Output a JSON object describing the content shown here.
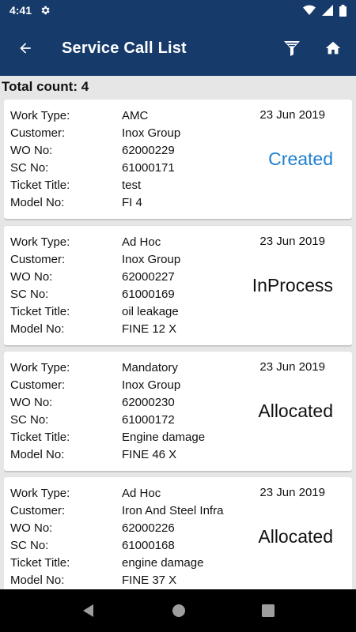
{
  "status_bar": {
    "time": "4:41"
  },
  "app_bar": {
    "title": "Service Call List"
  },
  "summary": {
    "total_count": "Total count: 4"
  },
  "labels": {
    "work_type": "Work Type:",
    "customer": "Customer:",
    "wo_no": "WO No:",
    "sc_no": "SC No:",
    "ticket_title": "Ticket Title:",
    "model_no": "Model No:"
  },
  "calls": [
    {
      "work_type": "AMC",
      "customer": "Inox Group",
      "wo_no": "62000229",
      "sc_no": "61000171",
      "ticket_title": "test",
      "model_no": "FI 4",
      "date": "23 Jun 2019",
      "status": "Created",
      "status_color": "#1e7fd0"
    },
    {
      "work_type": "Ad Hoc",
      "customer": "Inox Group",
      "wo_no": "62000227",
      "sc_no": "61000169",
      "ticket_title": "oil leakage",
      "model_no": "FINE 12 X",
      "date": "23 Jun 2019",
      "status": "InProcess",
      "status_color": "#111111"
    },
    {
      "work_type": "Mandatory",
      "customer": "Inox Group",
      "wo_no": "62000230",
      "sc_no": "61000172",
      "ticket_title": "Engine damage",
      "model_no": "FINE 46 X",
      "date": "23 Jun 2019",
      "status": "Allocated",
      "status_color": "#111111"
    },
    {
      "work_type": "Ad Hoc",
      "customer": "Iron And Steel Infra",
      "wo_no": "62000226",
      "sc_no": "61000168",
      "ticket_title": "engine damage",
      "model_no": "FINE 37 X",
      "date": "23 Jun 2019",
      "status": "Allocated",
      "status_color": "#111111"
    }
  ],
  "colors": {
    "primary": "#163a6a",
    "background": "#e6e6e6",
    "created_status": "#1e7fd0"
  }
}
